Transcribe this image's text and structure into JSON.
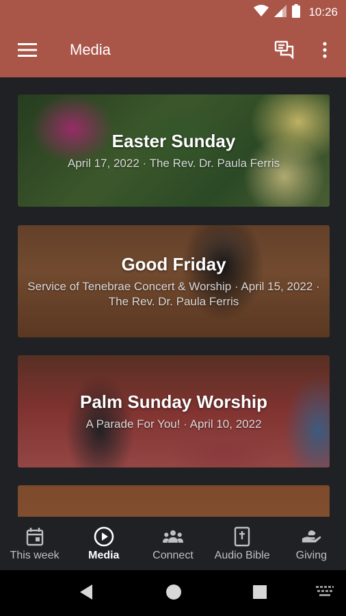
{
  "status_bar": {
    "time": "10:26",
    "icons": [
      "wifi-icon",
      "cell-signal-icon",
      "battery-icon"
    ]
  },
  "app_bar": {
    "title": "Media",
    "icons": [
      "menu-icon",
      "chat-icon",
      "more-vert-icon"
    ],
    "color": "#a95548"
  },
  "media": {
    "items": [
      {
        "title": "Easter Sunday",
        "subtitle": "April 17, 2022 · The Rev. Dr. Paula Ferris"
      },
      {
        "title": "Good Friday",
        "subtitle": "Service of Tenebrae Concert & Worship · April 15, 2022 · The Rev. Dr. Paula Ferris"
      },
      {
        "title": "Palm Sunday Worship",
        "subtitle": "A Parade For You! · April 10, 2022"
      },
      {
        "title": "",
        "subtitle": ""
      }
    ]
  },
  "bottom_nav": {
    "items": [
      {
        "label": "This week",
        "icon": "calendar-icon"
      },
      {
        "label": "Media",
        "icon": "play-circle-icon",
        "active": true
      },
      {
        "label": "Connect",
        "icon": "group-icon"
      },
      {
        "label": "Audio Bible",
        "icon": "bible-icon"
      },
      {
        "label": "Giving",
        "icon": "giving-hand-icon"
      }
    ]
  },
  "system_nav": {
    "icons": [
      "back-icon",
      "home-icon",
      "recents-icon",
      "keyboard-icon"
    ]
  }
}
